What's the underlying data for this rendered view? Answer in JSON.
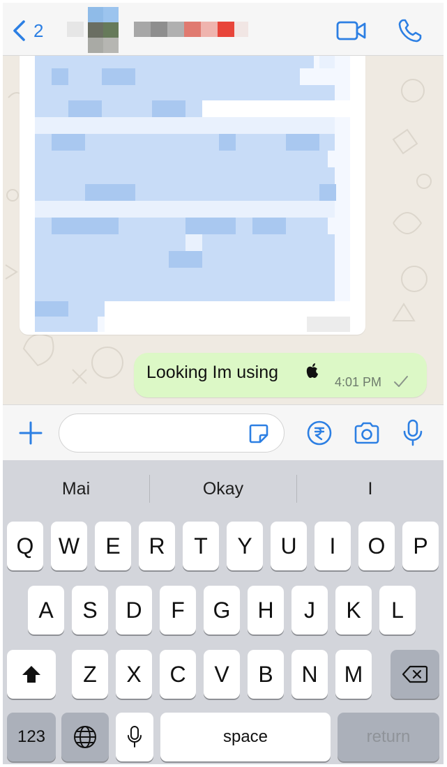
{
  "header": {
    "back_count": "2",
    "video_icon": "video-camera-icon",
    "phone_icon": "phone-icon"
  },
  "chat": {
    "outgoing_message": {
      "text": "Looking Im using",
      "emoji_icon": "apple-logo-icon",
      "time": "4:01 PM",
      "status_icon": "single-check-icon"
    }
  },
  "input_bar": {
    "message_value": "",
    "message_placeholder": "",
    "icons": [
      "plus-icon",
      "sticker-icon",
      "rupee-icon",
      "camera-icon",
      "microphone-icon"
    ]
  },
  "keyboard": {
    "suggestions": [
      "Mai",
      "Okay",
      "I"
    ],
    "row1": [
      "Q",
      "W",
      "E",
      "R",
      "T",
      "Y",
      "U",
      "I",
      "O",
      "P"
    ],
    "row2": [
      "A",
      "S",
      "D",
      "F",
      "G",
      "H",
      "J",
      "K",
      "L"
    ],
    "row3": [
      "Z",
      "X",
      "C",
      "V",
      "B",
      "N",
      "M"
    ],
    "numbers_key": "123",
    "space_key": "space",
    "return_key": "return"
  },
  "colors": {
    "accent": "#2c7fe3",
    "outgoing_bubble": "#dcf8c6",
    "chat_background": "#efeae2",
    "keyboard_background": "#d3d5db"
  }
}
